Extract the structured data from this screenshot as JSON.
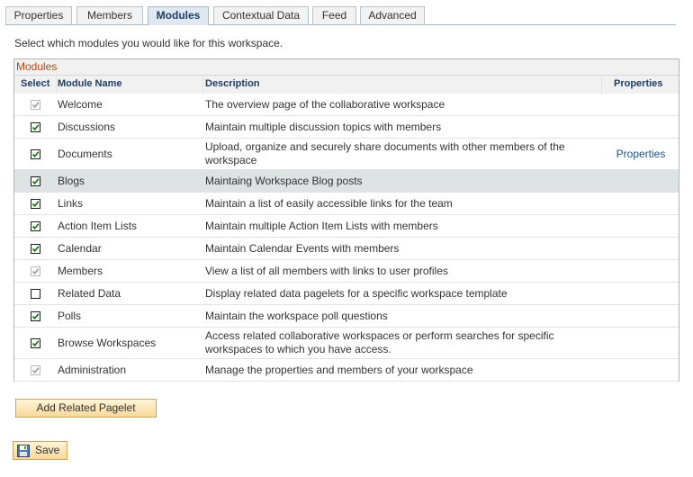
{
  "tabs": [
    {
      "label": "Properties",
      "active": false
    },
    {
      "label": "Members",
      "active": false
    },
    {
      "label": "Modules",
      "active": true
    },
    {
      "label": "Contextual Data",
      "active": false
    },
    {
      "label": "Feed",
      "active": false
    },
    {
      "label": "Advanced",
      "active": false
    }
  ],
  "instruction": "Select which modules you would like for this workspace.",
  "grid": {
    "title": "Modules",
    "headers": {
      "select": "Select",
      "name": "Module Name",
      "description": "Description",
      "properties": "Properties"
    },
    "rows": [
      {
        "name": "Welcome",
        "description": "The overview page of the collaborative workspace",
        "checked": true,
        "disabled": true,
        "properties": ""
      },
      {
        "name": "Discussions",
        "description": "Maintain multiple discussion topics with members",
        "checked": true,
        "disabled": false,
        "properties": ""
      },
      {
        "name": "Documents",
        "description": "Upload, organize and securely share documents with other members of the workspace",
        "checked": true,
        "disabled": false,
        "properties": "Properties"
      },
      {
        "name": "Blogs",
        "description": "Maintaing Workspace Blog posts",
        "checked": true,
        "disabled": false,
        "properties": "",
        "highlighted": true
      },
      {
        "name": "Links",
        "description": "Maintain a list of easily accessible links for the team",
        "checked": true,
        "disabled": false,
        "properties": ""
      },
      {
        "name": "Action Item Lists",
        "description": "Maintain multiple Action Item Lists with members",
        "checked": true,
        "disabled": false,
        "properties": ""
      },
      {
        "name": "Calendar",
        "description": "Maintain Calendar Events with members",
        "checked": true,
        "disabled": false,
        "properties": ""
      },
      {
        "name": "Members",
        "description": "View a list of all members with links to user profiles",
        "checked": true,
        "disabled": true,
        "properties": ""
      },
      {
        "name": "Related Data",
        "description": "Display related data pagelets for a specific workspace template",
        "checked": false,
        "disabled": false,
        "properties": ""
      },
      {
        "name": "Polls",
        "description": "Maintain the workspace poll questions",
        "checked": true,
        "disabled": false,
        "properties": ""
      },
      {
        "name": "Browse Workspaces",
        "description": "Access related collaborative workspaces or perform searches for specific workspaces to which you have access.",
        "checked": true,
        "disabled": false,
        "properties": ""
      },
      {
        "name": "Administration",
        "description": "Manage the properties and members of your workspace",
        "checked": true,
        "disabled": true,
        "properties": ""
      }
    ]
  },
  "buttons": {
    "add_related": "Add Related Pagelet",
    "save": "Save"
  },
  "colors": {
    "check_enabled": "#1a7a1a",
    "check_disabled": "#a0a0a0",
    "grid_title": "#bb4411",
    "link": "#1a4f8b"
  },
  "icons": {
    "save": "floppy-disk-icon",
    "checkbox": "checkmark-icon"
  }
}
